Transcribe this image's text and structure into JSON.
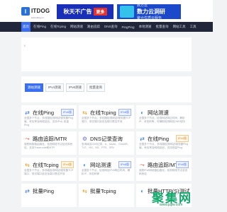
{
  "header": {
    "logo_text": "ITDOG",
    "logo_sub": "www.itdog.cn",
    "ad1_text": "秋天不广告",
    "ad1_tag": "更多",
    "ad2_brand": "数方云",
    "ad2_text": "数力云洞研",
    "ad2_sub": "聚合优质云服务"
  },
  "nav": {
    "items": [
      "首页",
      "在线Ping",
      "在线Tcping",
      "网站测速",
      "路由追踪",
      "DNS查询",
      "PingPing",
      "本地测速",
      "批量查询",
      "网站工具",
      "工具"
    ]
  },
  "tabs": [
    "源站测速",
    "IPv4测速",
    "IPv6测速",
    "批量查询"
  ],
  "cards": [
    {
      "title": "在线Ping",
      "badge": "IPv6版",
      "badge_type": "ipv6",
      "icon": "ping-icon",
      "desc": "全国多个节点，多线路检测网站/服务器Ping值、丢包率及网络延迟，支持IPv6, 批量Ping"
    },
    {
      "title": "在线Tcping",
      "badge": "IPv6版",
      "badge_type": "ipv6",
      "icon": "tcping-icon",
      "desc": "全国多个节点，多线路检测网站/服务器TCP端口，测试端口延迟及端口是否开放"
    },
    {
      "title": "网站测速",
      "badge": "",
      "badge_type": "",
      "icon": "website-speed-icon",
      "desc": "全国多个节点，检测网站响应时间、解析IP、状态码等，可辅助检测网站DNS劫持"
    },
    {
      "title": "路由追踪/MTR",
      "badge": "",
      "badge_type": "",
      "icon": "route-icon",
      "desc": "追踪网络路由路径，检测网络节点延迟和丢包，支持Traceroute和MTR"
    },
    {
      "title": "DNS记录查询",
      "badge": "",
      "badge_type": "",
      "icon": "dns-icon",
      "desc": "查询域名DNS记录，A、AAAA、CNAME、TXT、MX、NS、PTR、SRV"
    },
    {
      "title": "在线Ping",
      "badge": "IPv4版",
      "badge_type": "ipv4",
      "icon": "ping-icon",
      "desc": "全国多个节点，多线路检测网站/服务器Ping值、丢包率及网络延迟，支持批量Ping"
    },
    {
      "title": "在线Tcping",
      "badge": "IPv4版",
      "badge_type": "ipv4",
      "icon": "tcping-icon",
      "desc": "全国多个节点，多线路检测网站/服务器TCP端口，测试端口延迟及端口是否开放"
    },
    {
      "title": "网站测速",
      "badge": "IPv6版",
      "badge_type": "ipv6",
      "icon": "website-speed-icon",
      "desc": "全国多个节点，检测网站IPv6响应时间、解析IP、状态码等"
    },
    {
      "title": "路由追踪/MTR",
      "badge": "IPv6版",
      "badge_type": "ipv6",
      "icon": "route-icon",
      "desc": "追踪IPv6网络路由路径，检测网络节点延迟和丢包"
    },
    {
      "title": "批量Ping",
      "badge": "",
      "badge_type": "",
      "icon": "batch-ping-icon",
      "desc": ""
    },
    {
      "title": "批量Tcping",
      "badge": "",
      "badge_type": "",
      "icon": "batch-tcping-icon",
      "desc": ""
    },
    {
      "title": "批量HTTP(S)测试",
      "badge": "",
      "badge_type": "",
      "icon": "batch-http-icon",
      "desc": ""
    }
  ],
  "watermark": {
    "text": "聚集网",
    "domain": "www.jujiw.com"
  },
  "colors": {
    "accent": "#3a6ff2",
    "nav_bg": "#22263a",
    "ipv6": "#4f76e8",
    "ipv4": "#d58a14"
  }
}
